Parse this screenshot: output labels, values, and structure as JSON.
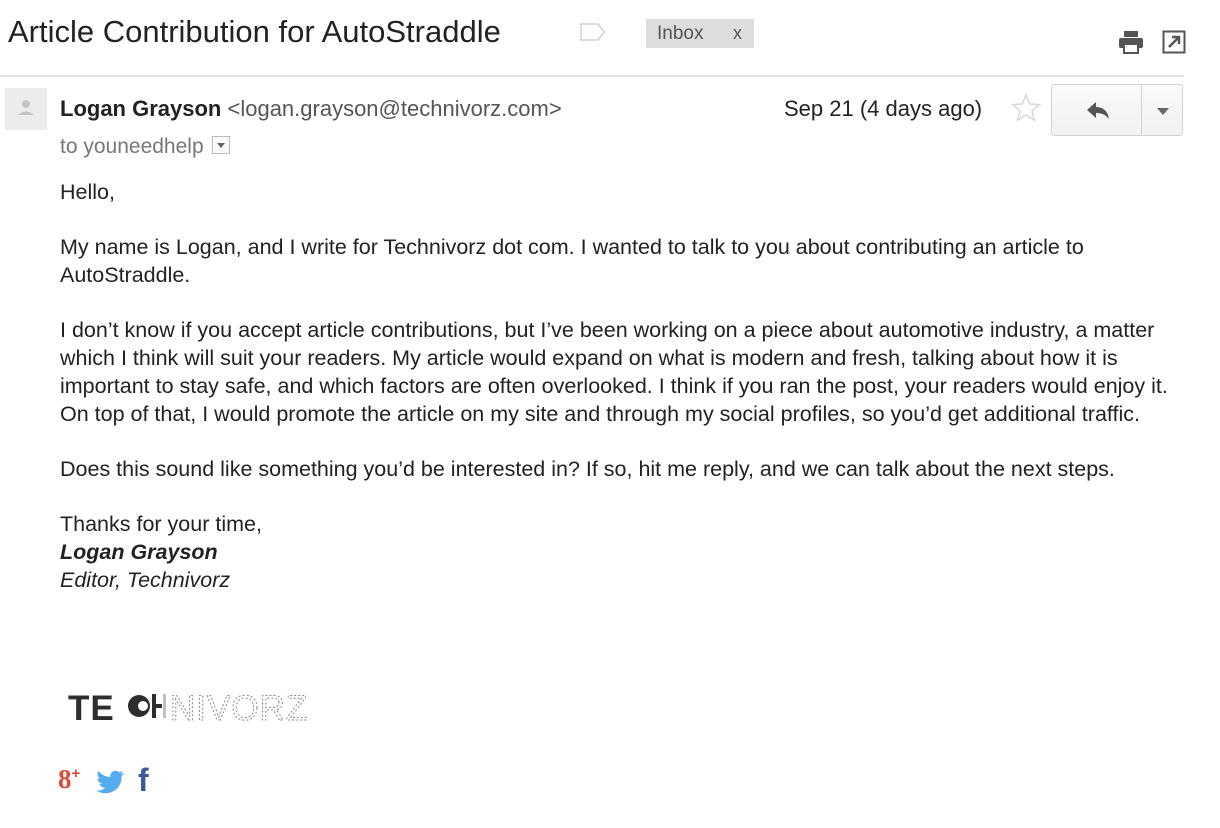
{
  "email": {
    "subject": "Article Contribution for AutoStraddle",
    "label_tag": "Inbox",
    "label_remove": "x"
  },
  "header": {
    "sender_name": "Logan Grayson",
    "sender_email": "<logan.grayson@technivorz.com>",
    "recipient": "to youneedhelp",
    "date": "Sep 21 (4 days ago)"
  },
  "body": {
    "greeting": "Hello,",
    "paragraphs": [
      "My name is Logan, and I write for Technivorz dot com. I wanted to talk to you about contributing an article to AutoStraddle.",
      "I don’t know if you accept article contributions, but I’ve been working on a piece about automotive industry, a matter which I think will suit your readers. My article would expand on what is modern and fresh, talking about how it is important to stay safe, and which factors are often overlooked. I think if you ran the post, your readers would enjoy it. On top of that, I would promote the article on my site and through my social profiles, so you’d get additional traffic.",
      "Does this sound like something you’d be interested in? If so, hit me reply, and we can talk about the next steps."
    ],
    "signoff": "Thanks for your time,",
    "signature_name": "Logan Grayson",
    "signature_title": "Editor, Technivorz"
  },
  "signature_logo": "TECHNIVORZ",
  "social": {
    "gplus": "8",
    "gplus_plus": "+",
    "facebook": "f"
  },
  "icons": {
    "label": "label-outline-icon",
    "print": "printer-icon",
    "popout": "new-window-icon",
    "star": "star-outline-icon",
    "reply": "reply-arrow-icon",
    "more": "chevron-down-icon",
    "avatar": "default-person-icon"
  },
  "colors": {
    "gplus": "#dd4b39",
    "twitter": "#55acee",
    "facebook": "#3b5998",
    "tag_bg": "#dddddd"
  }
}
